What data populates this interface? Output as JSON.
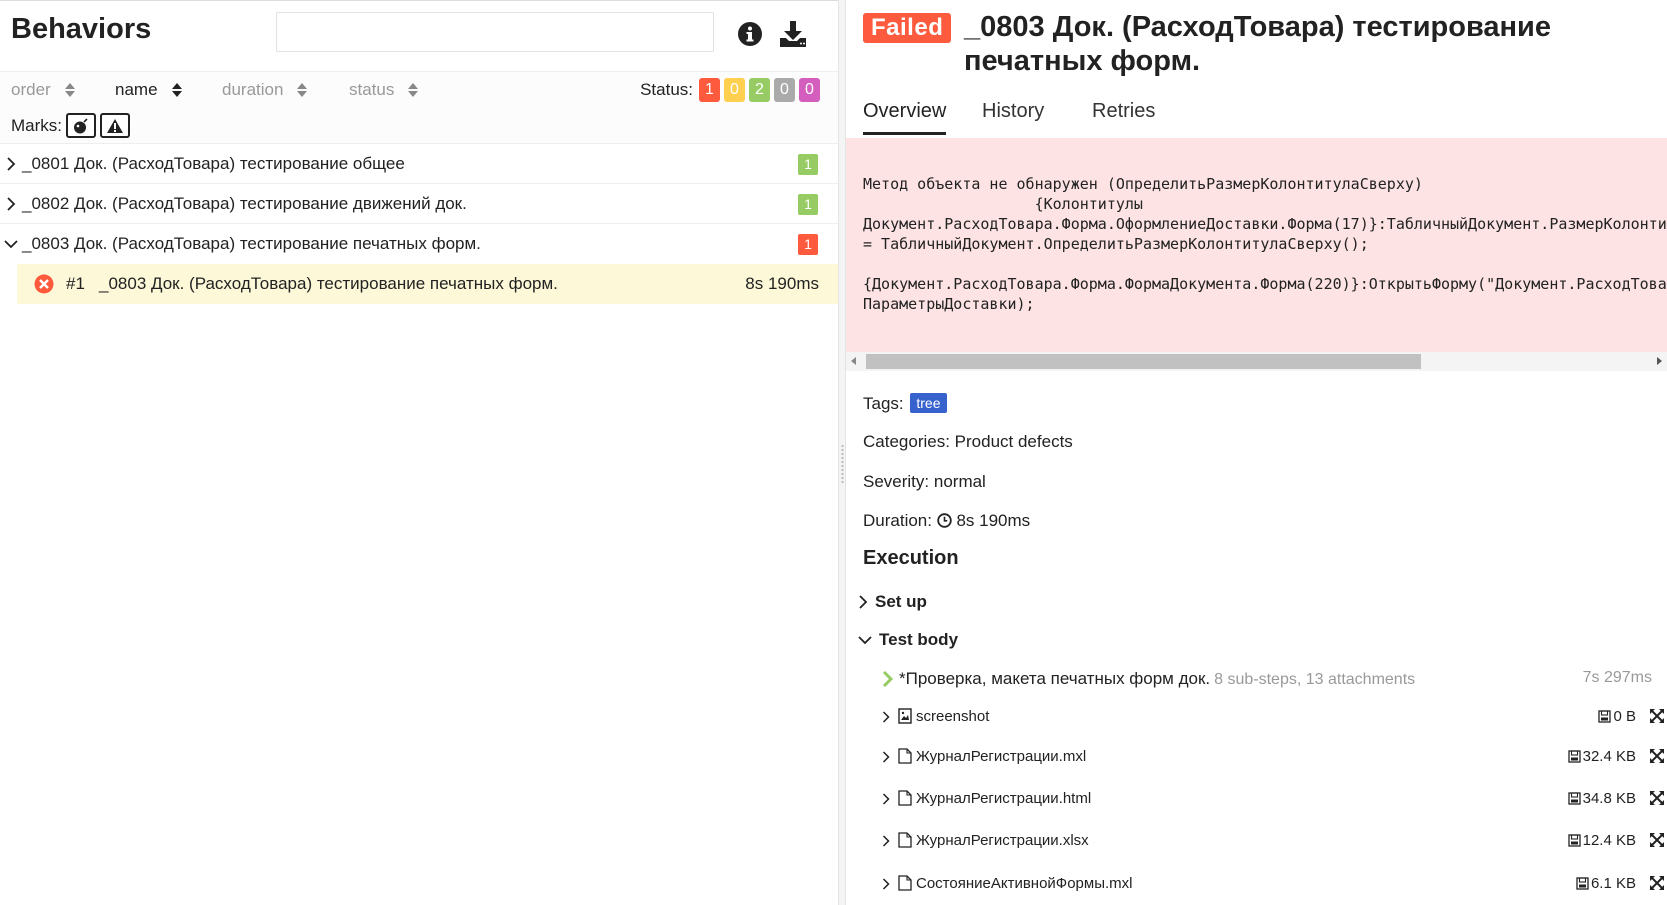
{
  "left": {
    "title": "Behaviors",
    "search_placeholder": "",
    "sort": [
      {
        "label": "order",
        "active": false
      },
      {
        "label": "name",
        "active": true
      },
      {
        "label": "duration",
        "active": false
      },
      {
        "label": "status",
        "active": false
      }
    ],
    "status_label": "Status:",
    "status_counts": [
      {
        "status": "failed",
        "count": "1",
        "color": "#fd5a3e"
      },
      {
        "status": "broken",
        "count": "0",
        "color": "#ffd050"
      },
      {
        "status": "passed",
        "count": "2",
        "color": "#97cc64"
      },
      {
        "status": "skipped",
        "count": "0",
        "color": "#aaaaaa"
      },
      {
        "status": "unknown",
        "count": "0",
        "color": "#d35ebe"
      }
    ],
    "marks_label": "Marks:",
    "groups": [
      {
        "name": "_0801 Док. (РасходТовара) тестирование общее",
        "count": "1",
        "color": "#97cc64",
        "expanded": false
      },
      {
        "name": "_0802 Док. (РасходТовара) тестирование движений док.",
        "count": "1",
        "color": "#97cc64",
        "expanded": false
      },
      {
        "name": "_0803 Док. (РасходТовара) тестирование печатных форм.",
        "count": "1",
        "color": "#fd5a3e",
        "expanded": true
      }
    ],
    "leaf": {
      "num": "#1",
      "name": "_0803 Док. (РасходТовара) тестирование печатных форм.",
      "duration": "8s 190ms"
    }
  },
  "right": {
    "status_badge": "Failed",
    "title": "_0803 Док. (РасходТовара) тестирование печатных форм.",
    "tabs": [
      "Overview",
      "History",
      "Retries"
    ],
    "error_text": "Метод объекта не обнаружен (ОпределитьРазмерКолонтитулаСверху)\n                   {Колонтитулы\nДокумент.РасходТовара.Форма.ОформлениеДоставки.Форма(17)}:ТабличныйДокумент.РазмерКолонтитулаСверху\n= ТабличныйДокумент.ОпределитьРазмерКолонтитулаСверху();\n\n{Документ.РасходТовара.Форма.ФормаДокумента.Форма(220)}:ОткрытьФорму(\"Документ.РасходТовара.Форма.ОформлениеДоставки\",\nПараметрыДоставки);",
    "tags_label": "Tags:",
    "tags": [
      "tree"
    ],
    "categories_label": "Categories:",
    "categories_value": "Product defects",
    "severity_label": "Severity:",
    "severity_value": "normal",
    "duration_label": "Duration:",
    "duration_value": "8s 190ms",
    "execution_title": "Execution",
    "setup_label": "Set up",
    "testbody_label": "Test body",
    "step": {
      "name": "*Проверка, макета печатных форм док.",
      "info": "8 sub-steps, 13 attachments",
      "duration": "7s 297ms"
    },
    "attachments": [
      {
        "name": "screenshot",
        "size": "0 B",
        "icon": "image-file-icon"
      },
      {
        "name": "ЖурналРегистрации.mxl",
        "size": "32.4 KB",
        "icon": "file-icon"
      },
      {
        "name": "ЖурналРегистрации.html",
        "size": "34.8 KB",
        "icon": "file-icon"
      },
      {
        "name": "ЖурналРегистрации.xlsx",
        "size": "12.4 KB",
        "icon": "file-icon"
      },
      {
        "name": "СостояниеАктивнойФормы.mxl",
        "size": "6.1 KB",
        "icon": "file-icon"
      }
    ]
  }
}
